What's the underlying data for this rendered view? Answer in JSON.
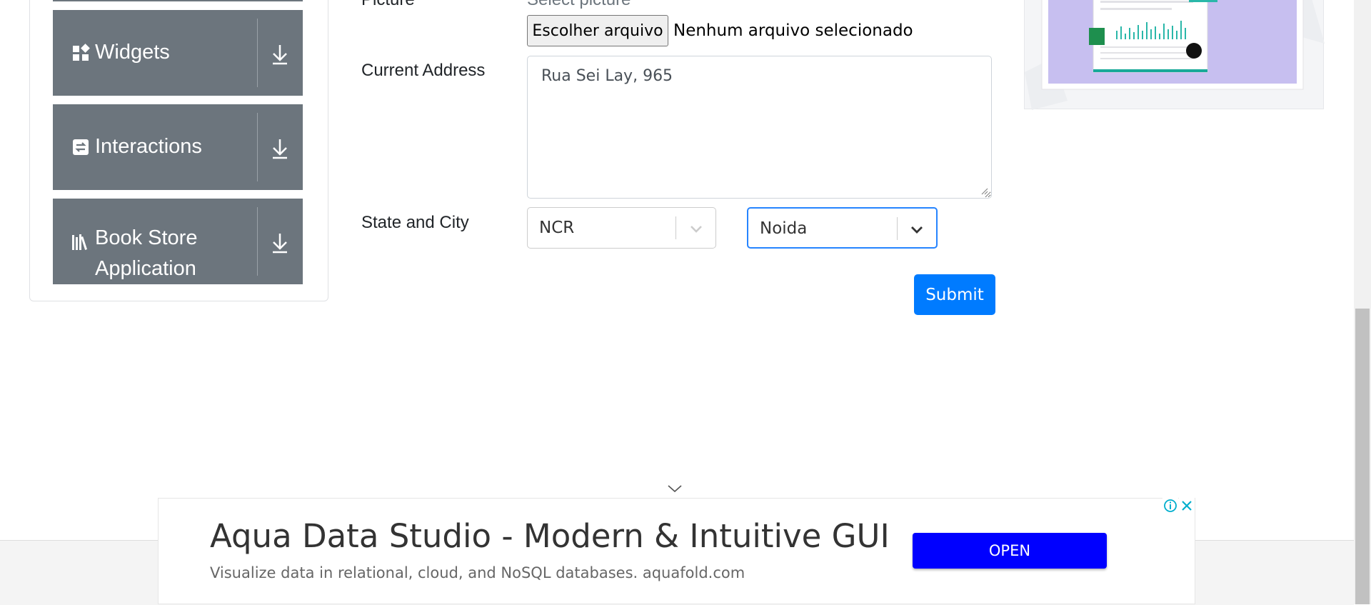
{
  "sidebar": {
    "groups": [
      {
        "label": "Widgets",
        "icon": "widgets-icon"
      },
      {
        "label": "Interactions",
        "icon": "interactions-icon"
      },
      {
        "label_line1": "Book Store",
        "label_line2": "Application",
        "icon": "book-store-icon"
      }
    ]
  },
  "form": {
    "picture_label": "Picture",
    "picture_hint": "Select picture",
    "file_button": "Escolher arquivo",
    "file_status": "Nenhum arquivo selecionado",
    "address_label": "Current Address",
    "address_value": "Rua Sei Lay, 965",
    "state_city_label": "State and City",
    "state_value": "NCR",
    "city_value": "Noida",
    "submit_label": "Submit"
  },
  "ad": {
    "title": "Aqua Data Studio - Modern & Intuitive GUI",
    "subtitle": "Visualize data in relational, cloud, and NoSQL databases. aquafold.com",
    "open_label": "OPEN"
  },
  "colors": {
    "accent": "#007bff",
    "sidebar_group": "#6c757d",
    "focus_border": "#2684ff",
    "ad_button": "#0000ff"
  }
}
